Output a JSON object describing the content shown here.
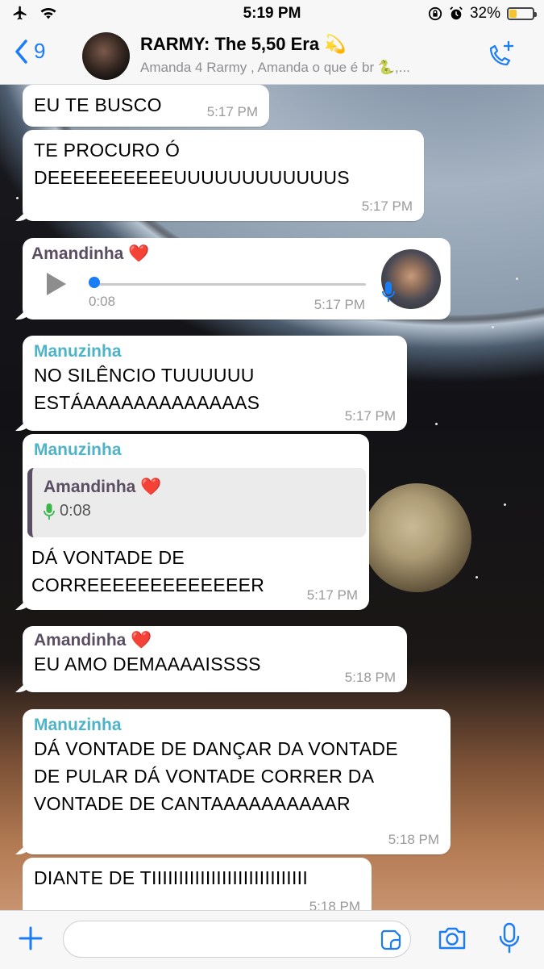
{
  "status_bar": {
    "time": "5:19 PM",
    "battery": "32%",
    "battery_level": 0.32
  },
  "header": {
    "back_count": "9",
    "title": "RARMY: The 5,50 Era 💫",
    "subtitle": "Amanda 4 Rarmy , Amanda o que é br 🐍,..."
  },
  "messages": [
    {
      "text": "EU TE BUSCO",
      "time": "5:17 PM"
    },
    {
      "text_lines": [
        "TE PROCURO Ó",
        "DEEEEEEEEEEUUUUUUUUUUUUS"
      ],
      "time": "5:17 PM"
    },
    {
      "sender": "Amandinha ❤️",
      "duration": "0:08",
      "time": "5:17 PM"
    },
    {
      "sender": "Manuzinha",
      "text_lines": [
        "NO SILÊNCIO TUUUUUU",
        "ESTÁAAAAAAAAAAAAAS"
      ],
      "time": "5:17 PM"
    },
    {
      "sender": "Manuzinha",
      "quote_sender": "Amandinha ❤️",
      "quote_duration": "0:08",
      "text_lines": [
        "DÁ VONTADE DE",
        "CORREEEEEEEEEEEEER"
      ],
      "time": "5:17 PM"
    },
    {
      "sender": "Amandinha ❤️",
      "text": "EU AMO DEMAAAAISSSS",
      "time": "5:18 PM"
    },
    {
      "sender": "Manuzinha",
      "text_lines": [
        "DÁ VONTADE DE DANÇAR DA VONTADE",
        "DE PULAR DÁ VONTADE CORRER DA",
        "VONTADE DE CANTAAAAAAAAAAR"
      ],
      "time": "5:18 PM"
    },
    {
      "text": "DIANTE DE TIIIIIIIIIIIIIIIIIIIIIIIIIIIII",
      "time": "5:18 PM"
    }
  ],
  "colors": {
    "accent": "#1a7cf6",
    "amanda_name": "#5a4e63",
    "manu_name": "#4fb3c8"
  }
}
